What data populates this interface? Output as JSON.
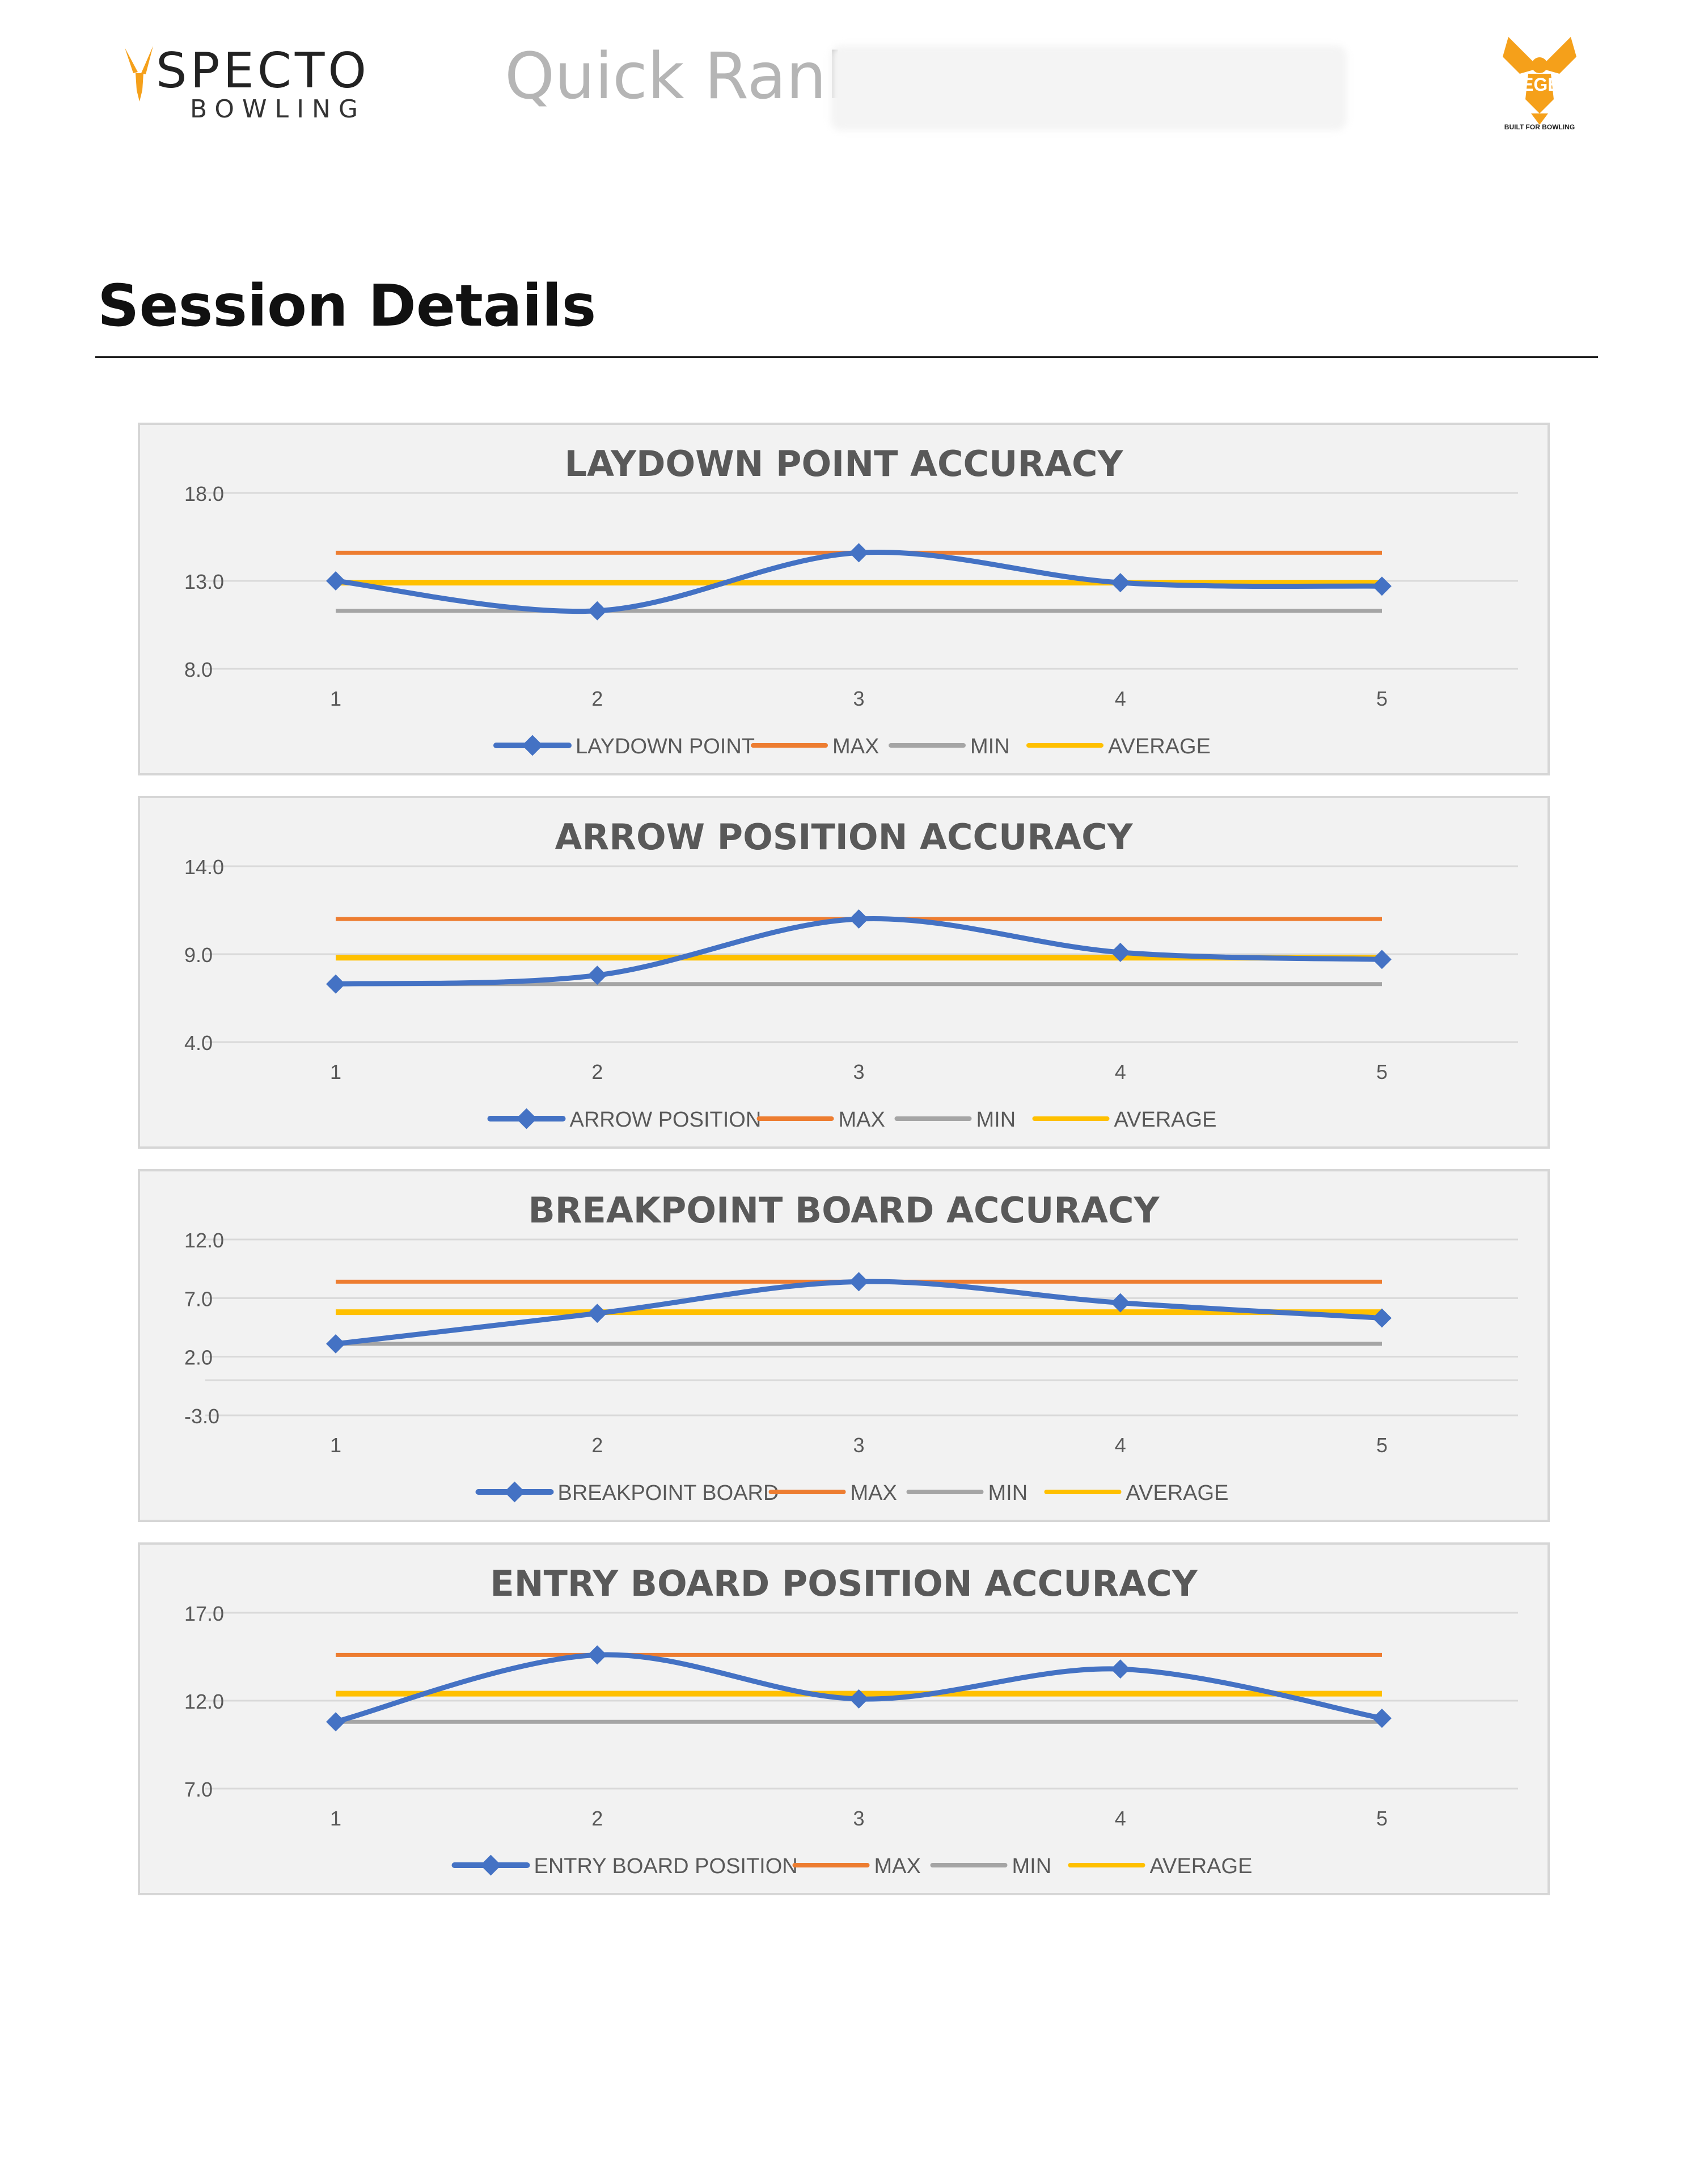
{
  "header": {
    "brand": "SPECTO",
    "brand_sub": "BOWLING",
    "report_title": "Quick Rank",
    "partner_logo_text": "KEGEL",
    "partner_tagline": "BUILT FOR BOWLING"
  },
  "section": {
    "title": "Session Details"
  },
  "colors": {
    "series": "#4472c4",
    "max": "#ed7d31",
    "min": "#a5a5a5",
    "average": "#ffc000",
    "brand_orange": "#f5a01a"
  },
  "chart_data": [
    {
      "type": "line",
      "title": "LAYDOWN POINT ACCURACY",
      "categories": [
        "1",
        "2",
        "3",
        "4",
        "5"
      ],
      "yticks": [
        "18.0",
        "13.0",
        "8.0"
      ],
      "ylim": [
        8,
        18
      ],
      "grid": true,
      "legend": "bottom",
      "series": [
        {
          "name": "LAYDOWN POINT",
          "values": [
            13.0,
            11.3,
            14.6,
            12.9,
            12.7
          ]
        },
        {
          "name": "MAX",
          "values": [
            14.6,
            14.6,
            14.6,
            14.6,
            14.6
          ]
        },
        {
          "name": "MIN",
          "values": [
            11.3,
            11.3,
            11.3,
            11.3,
            11.3
          ]
        },
        {
          "name": "AVERAGE",
          "values": [
            12.9,
            12.9,
            12.9,
            12.9,
            12.9
          ]
        }
      ]
    },
    {
      "type": "line",
      "title": "ARROW POSITION ACCURACY",
      "categories": [
        "1",
        "2",
        "3",
        "4",
        "5"
      ],
      "yticks": [
        "14.0",
        "9.0",
        "4.0"
      ],
      "ylim": [
        4,
        14
      ],
      "grid": true,
      "legend": "bottom",
      "series": [
        {
          "name": "ARROW POSITION",
          "values": [
            7.3,
            7.8,
            11.0,
            9.1,
            8.7
          ]
        },
        {
          "name": "MAX",
          "values": [
            11.0,
            11.0,
            11.0,
            11.0,
            11.0
          ]
        },
        {
          "name": "MIN",
          "values": [
            7.3,
            7.3,
            7.3,
            7.3,
            7.3
          ]
        },
        {
          "name": "AVERAGE",
          "values": [
            8.8,
            8.8,
            8.8,
            8.8,
            8.8
          ]
        }
      ]
    },
    {
      "type": "line",
      "title": "BREAKPOINT BOARD ACCURACY",
      "categories": [
        "1",
        "2",
        "3",
        "4",
        "5"
      ],
      "yticks": [
        "12.0",
        "7.0",
        "2.0",
        "-3.0"
      ],
      "ylim": [
        -3,
        12
      ],
      "grid": true,
      "legend": "bottom",
      "series": [
        {
          "name": "BREAKPOINT BOARD",
          "values": [
            3.1,
            5.7,
            8.4,
            6.6,
            5.3
          ]
        },
        {
          "name": "MAX",
          "values": [
            8.4,
            8.4,
            8.4,
            8.4,
            8.4
          ]
        },
        {
          "name": "MIN",
          "values": [
            3.1,
            3.1,
            3.1,
            3.1,
            3.1
          ]
        },
        {
          "name": "AVERAGE",
          "values": [
            5.8,
            5.8,
            5.8,
            5.8,
            5.8
          ]
        }
      ]
    },
    {
      "type": "line",
      "title": "ENTRY BOARD POSITION ACCURACY",
      "categories": [
        "1",
        "2",
        "3",
        "4",
        "5"
      ],
      "yticks": [
        "17.0",
        "12.0",
        "7.0"
      ],
      "ylim": [
        7,
        17
      ],
      "grid": true,
      "legend": "bottom",
      "series": [
        {
          "name": "ENTRY BOARD POSITION",
          "values": [
            10.8,
            14.6,
            12.1,
            13.8,
            11.0
          ]
        },
        {
          "name": "MAX",
          "values": [
            14.6,
            14.6,
            14.6,
            14.6,
            14.6
          ]
        },
        {
          "name": "MIN",
          "values": [
            10.8,
            10.8,
            10.8,
            10.8,
            10.8
          ]
        },
        {
          "name": "AVERAGE",
          "values": [
            12.4,
            12.4,
            12.4,
            12.4,
            12.4
          ]
        }
      ]
    }
  ]
}
